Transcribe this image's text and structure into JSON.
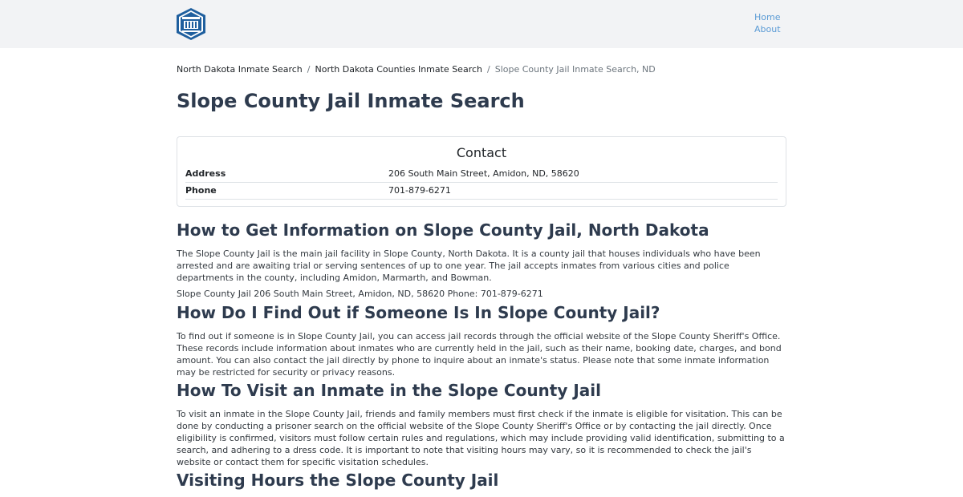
{
  "nav": {
    "logo_name": "site-logo",
    "links": [
      "Home",
      "About"
    ]
  },
  "breadcrumb": {
    "items": [
      "North Dakota Inmate Search",
      "North Dakota Counties Inmate Search"
    ],
    "current": "Slope County Jail Inmate Search, ND",
    "separator": "/"
  },
  "page_title": "Slope County Jail Inmate Search",
  "contact": {
    "title": "Contact",
    "rows": [
      {
        "label": "Address",
        "value": "206 South Main Street, Amidon, ND, 58620"
      },
      {
        "label": "Phone",
        "value": "701-879-6271"
      }
    ]
  },
  "sections": [
    {
      "heading": "How to Get Information on Slope County Jail, North Dakota",
      "paragraphs": [
        "The Slope County Jail is the main jail facility in Slope County, North Dakota. It is a county jail that houses individuals who have been arrested and are awaiting trial or serving sentences of up to one year. The jail accepts inmates from various cities and police departments in the county, including Amidon, Marmarth, and Bowman.",
        "Slope County Jail 206 South Main Street, Amidon, ND, 58620 Phone: 701-879-6271"
      ]
    },
    {
      "heading": "How Do I Find Out if Someone Is In Slope County Jail?",
      "paragraphs": [
        "To find out if someone is in Slope County Jail, you can access jail records through the official website of the Slope County Sheriff's Office. These records include information about inmates who are currently held in the jail, such as their name, booking date, charges, and bond amount. You can also contact the jail directly by phone to inquire about an inmate's status. Please note that some inmate information may be restricted for security or privacy reasons."
      ]
    },
    {
      "heading": "How To Visit an Inmate in the Slope County Jail",
      "paragraphs": [
        "To visit an inmate in the Slope County Jail, friends and family members must first check if the inmate is eligible for visitation. This can be done by conducting a prisoner search on the official website of the Slope County Sheriff's Office or by contacting the jail directly. Once eligibility is confirmed, visitors must follow certain rules and regulations, which may include providing valid identification, submitting to a search, and adhering to a dress code. It is important to note that visiting hours may vary, so it is recommended to check the jail's website or contact them for specific visitation schedules."
      ]
    },
    {
      "heading": "Visiting Hours the Slope County Jail",
      "paragraphs": []
    }
  ],
  "colors": {
    "navbar_bg": "#f2f3f5",
    "link": "#5b9bd5",
    "heading": "#2e3b4e",
    "logo_blue": "#1f5f9e"
  }
}
